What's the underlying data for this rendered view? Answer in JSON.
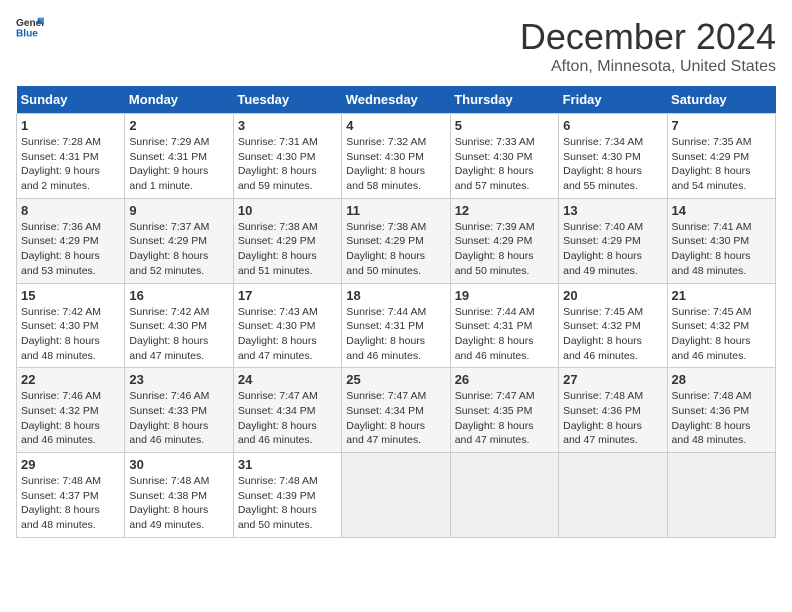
{
  "logo": {
    "general": "General",
    "blue": "Blue"
  },
  "title": "December 2024",
  "subtitle": "Afton, Minnesota, United States",
  "days_of_week": [
    "Sunday",
    "Monday",
    "Tuesday",
    "Wednesday",
    "Thursday",
    "Friday",
    "Saturday"
  ],
  "weeks": [
    [
      {
        "day": "1",
        "text": "Sunrise: 7:28 AM\nSunset: 4:31 PM\nDaylight: 9 hours\nand 2 minutes."
      },
      {
        "day": "2",
        "text": "Sunrise: 7:29 AM\nSunset: 4:31 PM\nDaylight: 9 hours\nand 1 minute."
      },
      {
        "day": "3",
        "text": "Sunrise: 7:31 AM\nSunset: 4:30 PM\nDaylight: 8 hours\nand 59 minutes."
      },
      {
        "day": "4",
        "text": "Sunrise: 7:32 AM\nSunset: 4:30 PM\nDaylight: 8 hours\nand 58 minutes."
      },
      {
        "day": "5",
        "text": "Sunrise: 7:33 AM\nSunset: 4:30 PM\nDaylight: 8 hours\nand 57 minutes."
      },
      {
        "day": "6",
        "text": "Sunrise: 7:34 AM\nSunset: 4:30 PM\nDaylight: 8 hours\nand 55 minutes."
      },
      {
        "day": "7",
        "text": "Sunrise: 7:35 AM\nSunset: 4:29 PM\nDaylight: 8 hours\nand 54 minutes."
      }
    ],
    [
      {
        "day": "8",
        "text": "Sunrise: 7:36 AM\nSunset: 4:29 PM\nDaylight: 8 hours\nand 53 minutes."
      },
      {
        "day": "9",
        "text": "Sunrise: 7:37 AM\nSunset: 4:29 PM\nDaylight: 8 hours\nand 52 minutes."
      },
      {
        "day": "10",
        "text": "Sunrise: 7:38 AM\nSunset: 4:29 PM\nDaylight: 8 hours\nand 51 minutes."
      },
      {
        "day": "11",
        "text": "Sunrise: 7:38 AM\nSunset: 4:29 PM\nDaylight: 8 hours\nand 50 minutes."
      },
      {
        "day": "12",
        "text": "Sunrise: 7:39 AM\nSunset: 4:29 PM\nDaylight: 8 hours\nand 50 minutes."
      },
      {
        "day": "13",
        "text": "Sunrise: 7:40 AM\nSunset: 4:29 PM\nDaylight: 8 hours\nand 49 minutes."
      },
      {
        "day": "14",
        "text": "Sunrise: 7:41 AM\nSunset: 4:30 PM\nDaylight: 8 hours\nand 48 minutes."
      }
    ],
    [
      {
        "day": "15",
        "text": "Sunrise: 7:42 AM\nSunset: 4:30 PM\nDaylight: 8 hours\nand 48 minutes."
      },
      {
        "day": "16",
        "text": "Sunrise: 7:42 AM\nSunset: 4:30 PM\nDaylight: 8 hours\nand 47 minutes."
      },
      {
        "day": "17",
        "text": "Sunrise: 7:43 AM\nSunset: 4:30 PM\nDaylight: 8 hours\nand 47 minutes."
      },
      {
        "day": "18",
        "text": "Sunrise: 7:44 AM\nSunset: 4:31 PM\nDaylight: 8 hours\nand 46 minutes."
      },
      {
        "day": "19",
        "text": "Sunrise: 7:44 AM\nSunset: 4:31 PM\nDaylight: 8 hours\nand 46 minutes."
      },
      {
        "day": "20",
        "text": "Sunrise: 7:45 AM\nSunset: 4:32 PM\nDaylight: 8 hours\nand 46 minutes."
      },
      {
        "day": "21",
        "text": "Sunrise: 7:45 AM\nSunset: 4:32 PM\nDaylight: 8 hours\nand 46 minutes."
      }
    ],
    [
      {
        "day": "22",
        "text": "Sunrise: 7:46 AM\nSunset: 4:32 PM\nDaylight: 8 hours\nand 46 minutes."
      },
      {
        "day": "23",
        "text": "Sunrise: 7:46 AM\nSunset: 4:33 PM\nDaylight: 8 hours\nand 46 minutes."
      },
      {
        "day": "24",
        "text": "Sunrise: 7:47 AM\nSunset: 4:34 PM\nDaylight: 8 hours\nand 46 minutes."
      },
      {
        "day": "25",
        "text": "Sunrise: 7:47 AM\nSunset: 4:34 PM\nDaylight: 8 hours\nand 47 minutes."
      },
      {
        "day": "26",
        "text": "Sunrise: 7:47 AM\nSunset: 4:35 PM\nDaylight: 8 hours\nand 47 minutes."
      },
      {
        "day": "27",
        "text": "Sunrise: 7:48 AM\nSunset: 4:36 PM\nDaylight: 8 hours\nand 47 minutes."
      },
      {
        "day": "28",
        "text": "Sunrise: 7:48 AM\nSunset: 4:36 PM\nDaylight: 8 hours\nand 48 minutes."
      }
    ],
    [
      {
        "day": "29",
        "text": "Sunrise: 7:48 AM\nSunset: 4:37 PM\nDaylight: 8 hours\nand 48 minutes."
      },
      {
        "day": "30",
        "text": "Sunrise: 7:48 AM\nSunset: 4:38 PM\nDaylight: 8 hours\nand 49 minutes."
      },
      {
        "day": "31",
        "text": "Sunrise: 7:48 AM\nSunset: 4:39 PM\nDaylight: 8 hours\nand 50 minutes."
      },
      {
        "day": "",
        "text": ""
      },
      {
        "day": "",
        "text": ""
      },
      {
        "day": "",
        "text": ""
      },
      {
        "day": "",
        "text": ""
      }
    ]
  ]
}
